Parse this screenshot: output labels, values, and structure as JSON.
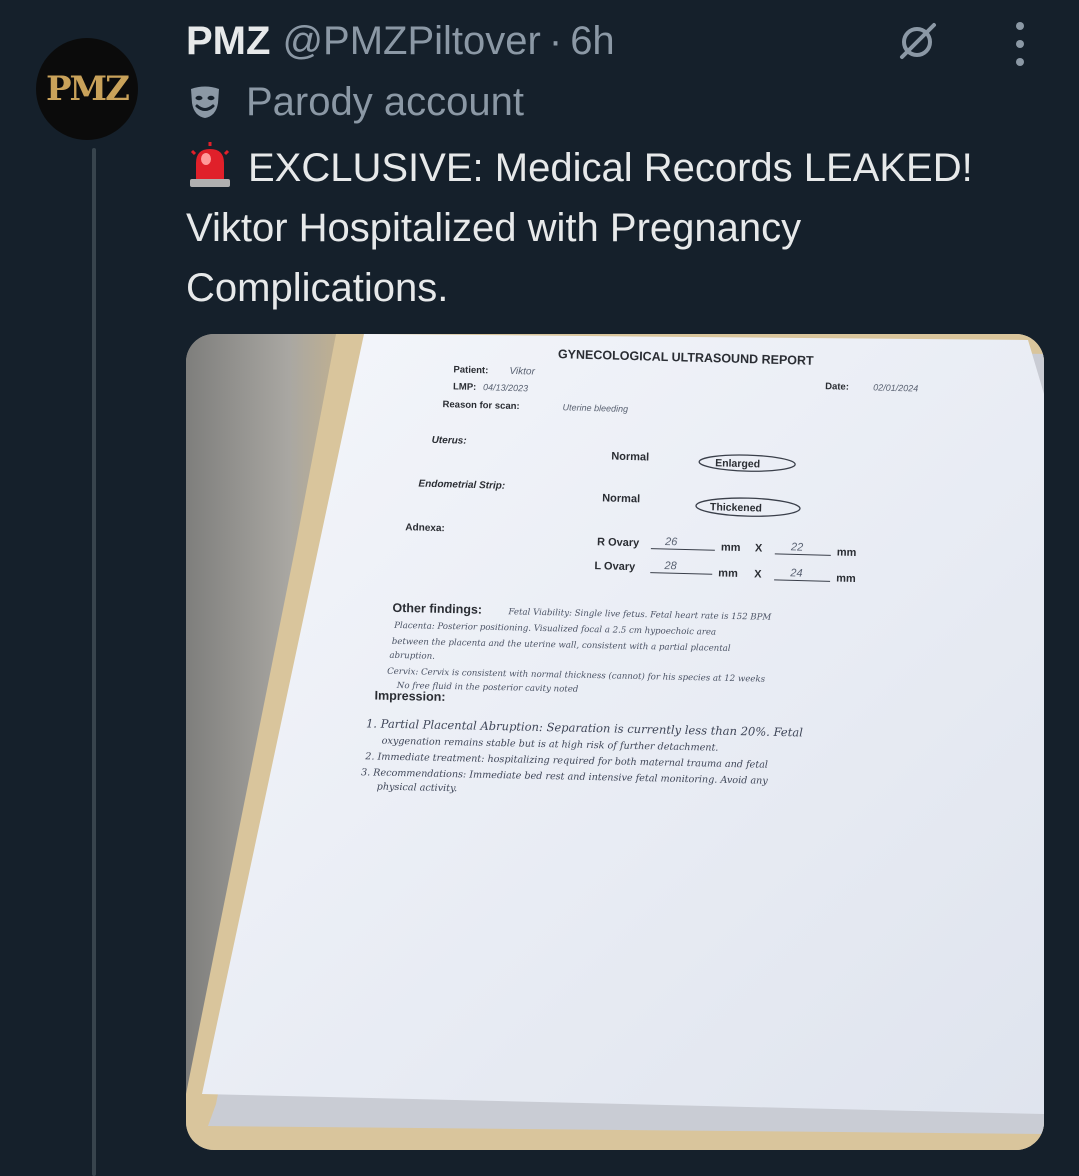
{
  "tweet": {
    "avatar_text": "PMZ",
    "display_name": "PMZ",
    "handle": "@PMZPiltover",
    "separator": "·",
    "time": "6h",
    "parody_label": "Parody account",
    "text_line1": "EXCLUSIVE: Medical Records LEAKED!",
    "text_line2": "Viktor Hospitalized with Pregnancy",
    "text_line3": "Complications."
  },
  "icons": {
    "grok": "grok-icon",
    "more": "more-options-icon",
    "parody": "theater-mask-icon",
    "siren": "police-siren-emoji"
  },
  "document": {
    "title": "GYNECOLOGICAL ULTRASOUND REPORT",
    "patient_label": "Patient:",
    "patient_value": "Viktor",
    "lmp_label": "LMP:",
    "lmp_value": "04/13/2023",
    "reason_label": "Reason for scan:",
    "reason_value": "Uterine bleeding",
    "date_label": "Date:",
    "date_value": "02/01/2024",
    "uterus_label": "Uterus:",
    "uterus_normal": "Normal",
    "uterus_selected": "Enlarged",
    "endometrial_label": "Endometrial Strip:",
    "endometrial_normal": "Normal",
    "endometrial_selected": "Thickened",
    "adnexa_label": "Adnexa:",
    "r_ovary_label": "R Ovary",
    "r_ovary_a": "26",
    "r_ovary_b": "22",
    "l_ovary_label": "L Ovary",
    "l_ovary_a": "28",
    "l_ovary_b": "24",
    "mm": "mm",
    "x": "X",
    "other_label": "Other findings:",
    "other_1": "Fetal Viability: Single live fetus. Fetal heart rate is 152 BPM",
    "other_2": "Placenta: Posterior positioning. Visualized focal a 2.5 cm hypoechoic area",
    "other_3": "between the placenta and the uterine wall, consistent with a partial placental",
    "other_4": "abruption.",
    "other_5": "Cervix: Cervix is consistent with normal thickness (cannot) for his species at 12 weeks",
    "other_6": "No free fluid in the posterior cavity noted",
    "impression_label": "Impression:",
    "imp_1a": "1. Partial Placental Abruption: Separation is currently less than 20%. Fetal",
    "imp_1b": "oxygenation remains stable but is at high risk of further detachment.",
    "imp_2": "2. Immediate treatment: hospitalizing required for both maternal trauma and fetal",
    "imp_3a": "3. Recommendations: Immediate bed rest and intensive fetal monitoring. Avoid any",
    "imp_3b": "physical activity."
  },
  "colors": {
    "background": "#15202b",
    "primary_text": "#e7e9ea",
    "secondary_text": "#8b98a5",
    "thread_line": "#38444d",
    "avatar_gold": "#c9a25a"
  }
}
